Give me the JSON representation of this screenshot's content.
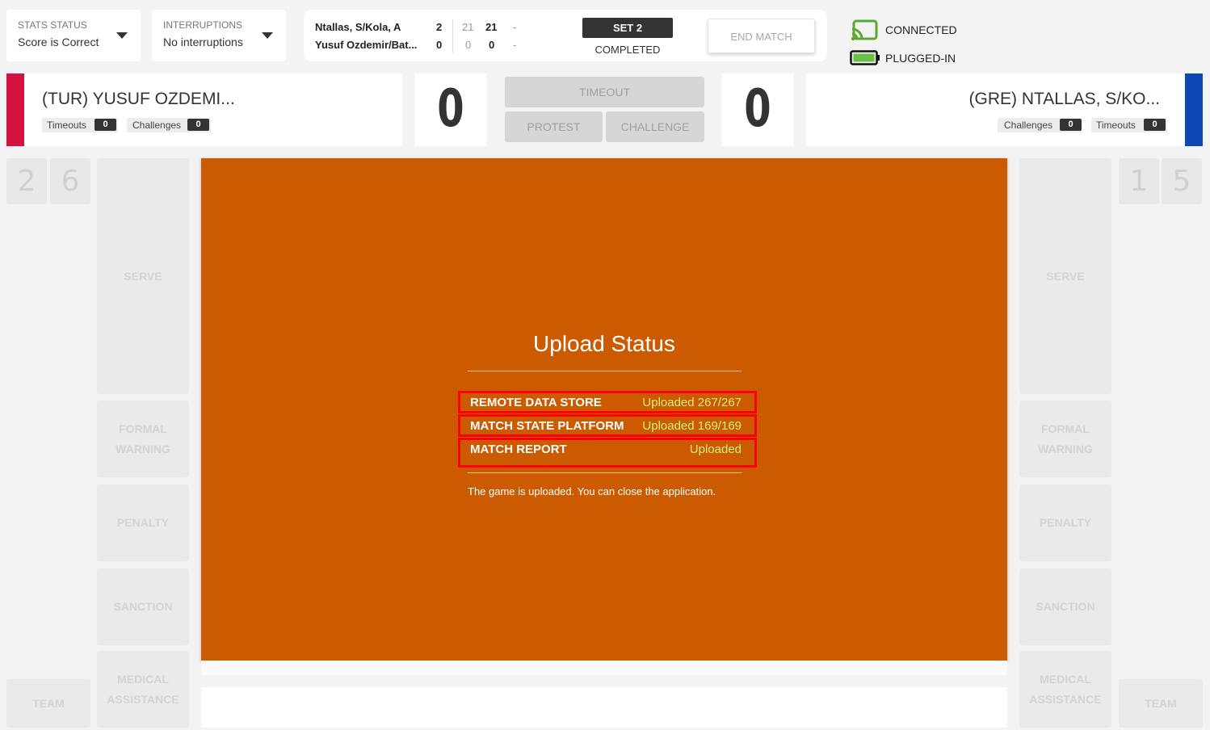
{
  "stats_status": {
    "label": "STATS STATUS",
    "value": "Score is Correct"
  },
  "interruptions": {
    "label": "INTERRUPTIONS",
    "value": "No interruptions"
  },
  "scoreboard": {
    "team_top": "Ntallas, S/Kola, A",
    "team_bottom": "Yusuf Ozdemir/Bat...",
    "top_sets": "2",
    "top_s1": "21",
    "top_s2": "21",
    "top_s3": "-",
    "bottom_sets": "0",
    "bottom_s1": "0",
    "bottom_s2": "0",
    "bottom_s3": "-",
    "set_label": "SET 2",
    "set_status": "COMPLETED",
    "end_match": "END MATCH"
  },
  "connection": {
    "status": "CONNECTED",
    "power": "PLUGGED-IN",
    "cast_color": "#5ba92f",
    "battery_color": "#6cc04a"
  },
  "left_team": {
    "name": "(TUR) YUSUF OZDEMI...",
    "color": "#d4123f",
    "timeouts_label": "Timeouts",
    "timeouts": "0",
    "challenges_label": "Challenges",
    "challenges": "0",
    "score": "0",
    "digits": [
      "2",
      "6"
    ]
  },
  "right_team": {
    "name": "(GRE) NTALLAS, S/KO...",
    "color": "#0d47b6",
    "timeouts_label": "Timeouts",
    "timeouts": "0",
    "challenges_label": "Challenges",
    "challenges": "0",
    "score": "0",
    "digits": [
      "1",
      "5"
    ]
  },
  "center_buttons": {
    "timeout": "TIMEOUT",
    "protest": "PROTEST",
    "challenge": "CHALLENGE"
  },
  "side_buttons": {
    "serve": "SERVE",
    "formal_warning_1": "FORMAL",
    "formal_warning_2": "WARNING",
    "penalty": "PENALTY",
    "sanction": "SANCTION",
    "medical_1": "MEDICAL",
    "medical_2": "ASSISTANCE",
    "team": "TEAM"
  },
  "upload": {
    "title": "Upload Status",
    "rows": [
      {
        "key": "REMOTE DATA STORE",
        "value": "Uploaded 267/267"
      },
      {
        "key": "MATCH STATE PLATFORM",
        "value": "Uploaded 169/169"
      },
      {
        "key": "MATCH REPORT",
        "value": "Uploaded"
      }
    ],
    "message": "The game is uploaded. You can close the application.",
    "bg_color": "#cc5a00"
  }
}
